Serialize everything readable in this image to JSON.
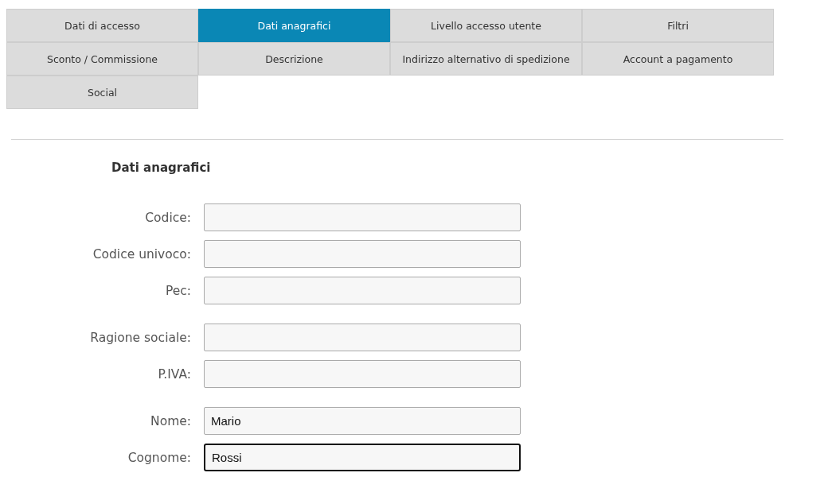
{
  "tabs": [
    {
      "label": "Dati di accesso",
      "selected": false
    },
    {
      "label": "Dati anagrafici",
      "selected": true
    },
    {
      "label": "Livello accesso utente",
      "selected": false
    },
    {
      "label": "Filtri",
      "selected": false
    },
    {
      "label": "Sconto / Commissione",
      "selected": false
    },
    {
      "label": "Descrizione",
      "selected": false
    },
    {
      "label": "Indirizzo alternativo di spedizione",
      "selected": false
    },
    {
      "label": "Account a pagamento",
      "selected": false
    },
    {
      "label": "Social",
      "selected": false
    }
  ],
  "section": {
    "title": "Dati anagrafici",
    "groups": [
      [
        {
          "label": "Codice:",
          "focused": false
        },
        {
          "label": "Codice univoco:",
          "focused": false
        },
        {
          "label": "Pec:",
          "focused": false
        }
      ],
      [
        {
          "label": "Ragione sociale:",
          "focused": false
        },
        {
          "label": "P.IVA:",
          "focused": false
        }
      ],
      [
        {
          "label": "Nome:",
          "value": "Mario",
          "focused": false
        },
        {
          "label": "Cognome:",
          "value": "Rossi",
          "focused": true
        }
      ]
    ]
  }
}
